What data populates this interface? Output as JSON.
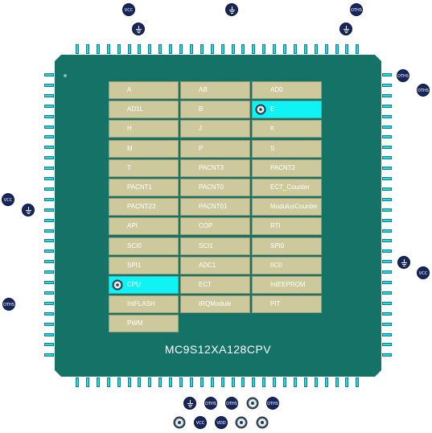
{
  "chip": {
    "name": "MC9S12XA128CPV"
  },
  "modules": [
    {
      "label": "A",
      "active": false
    },
    {
      "label": "AB",
      "active": false
    },
    {
      "label": "AD0",
      "active": false
    },
    {
      "label": "AD1L",
      "active": false
    },
    {
      "label": "B",
      "active": false
    },
    {
      "label": "E",
      "active": true
    },
    {
      "label": "H",
      "active": false
    },
    {
      "label": "J",
      "active": false
    },
    {
      "label": "K",
      "active": false
    },
    {
      "label": "M",
      "active": false
    },
    {
      "label": "P",
      "active": false
    },
    {
      "label": "S",
      "active": false
    },
    {
      "label": "T",
      "active": false
    },
    {
      "label": "PACNT3",
      "active": false
    },
    {
      "label": "PACNT2",
      "active": false
    },
    {
      "label": "PACNT1",
      "active": false
    },
    {
      "label": "PACNT0",
      "active": false
    },
    {
      "label": "ECT_Counter",
      "active": false
    },
    {
      "label": "PACNT23",
      "active": false
    },
    {
      "label": "PACNT01",
      "active": false
    },
    {
      "label": "ModulusCounter",
      "active": false
    },
    {
      "label": "API",
      "active": false
    },
    {
      "label": "COP",
      "active": false
    },
    {
      "label": "RTI",
      "active": false
    },
    {
      "label": "SCI0",
      "active": false
    },
    {
      "label": "SCI1",
      "active": false
    },
    {
      "label": "SPI0",
      "active": false
    },
    {
      "label": "SPI1",
      "active": false
    },
    {
      "label": "ADC1",
      "active": false
    },
    {
      "label": "IIC0",
      "active": false
    },
    {
      "label": "CPU",
      "active": true
    },
    {
      "label": "ECT",
      "active": false
    },
    {
      "label": "IntEEPROM",
      "active": false
    },
    {
      "label": "IntFLASH",
      "active": false
    },
    {
      "label": "IRQModule",
      "active": false
    },
    {
      "label": "PIT",
      "active": false
    },
    {
      "label": "PWM",
      "active": false
    }
  ],
  "power_labels": {
    "vcc": "VCC",
    "vdd": "VDD",
    "others": "OTHS"
  },
  "colors": {
    "chip": "#157266",
    "pin": "#2fd6e6",
    "cell": "#cdc99c",
    "cell_active": "#10f2f4",
    "power_symbol": "#17275c"
  }
}
